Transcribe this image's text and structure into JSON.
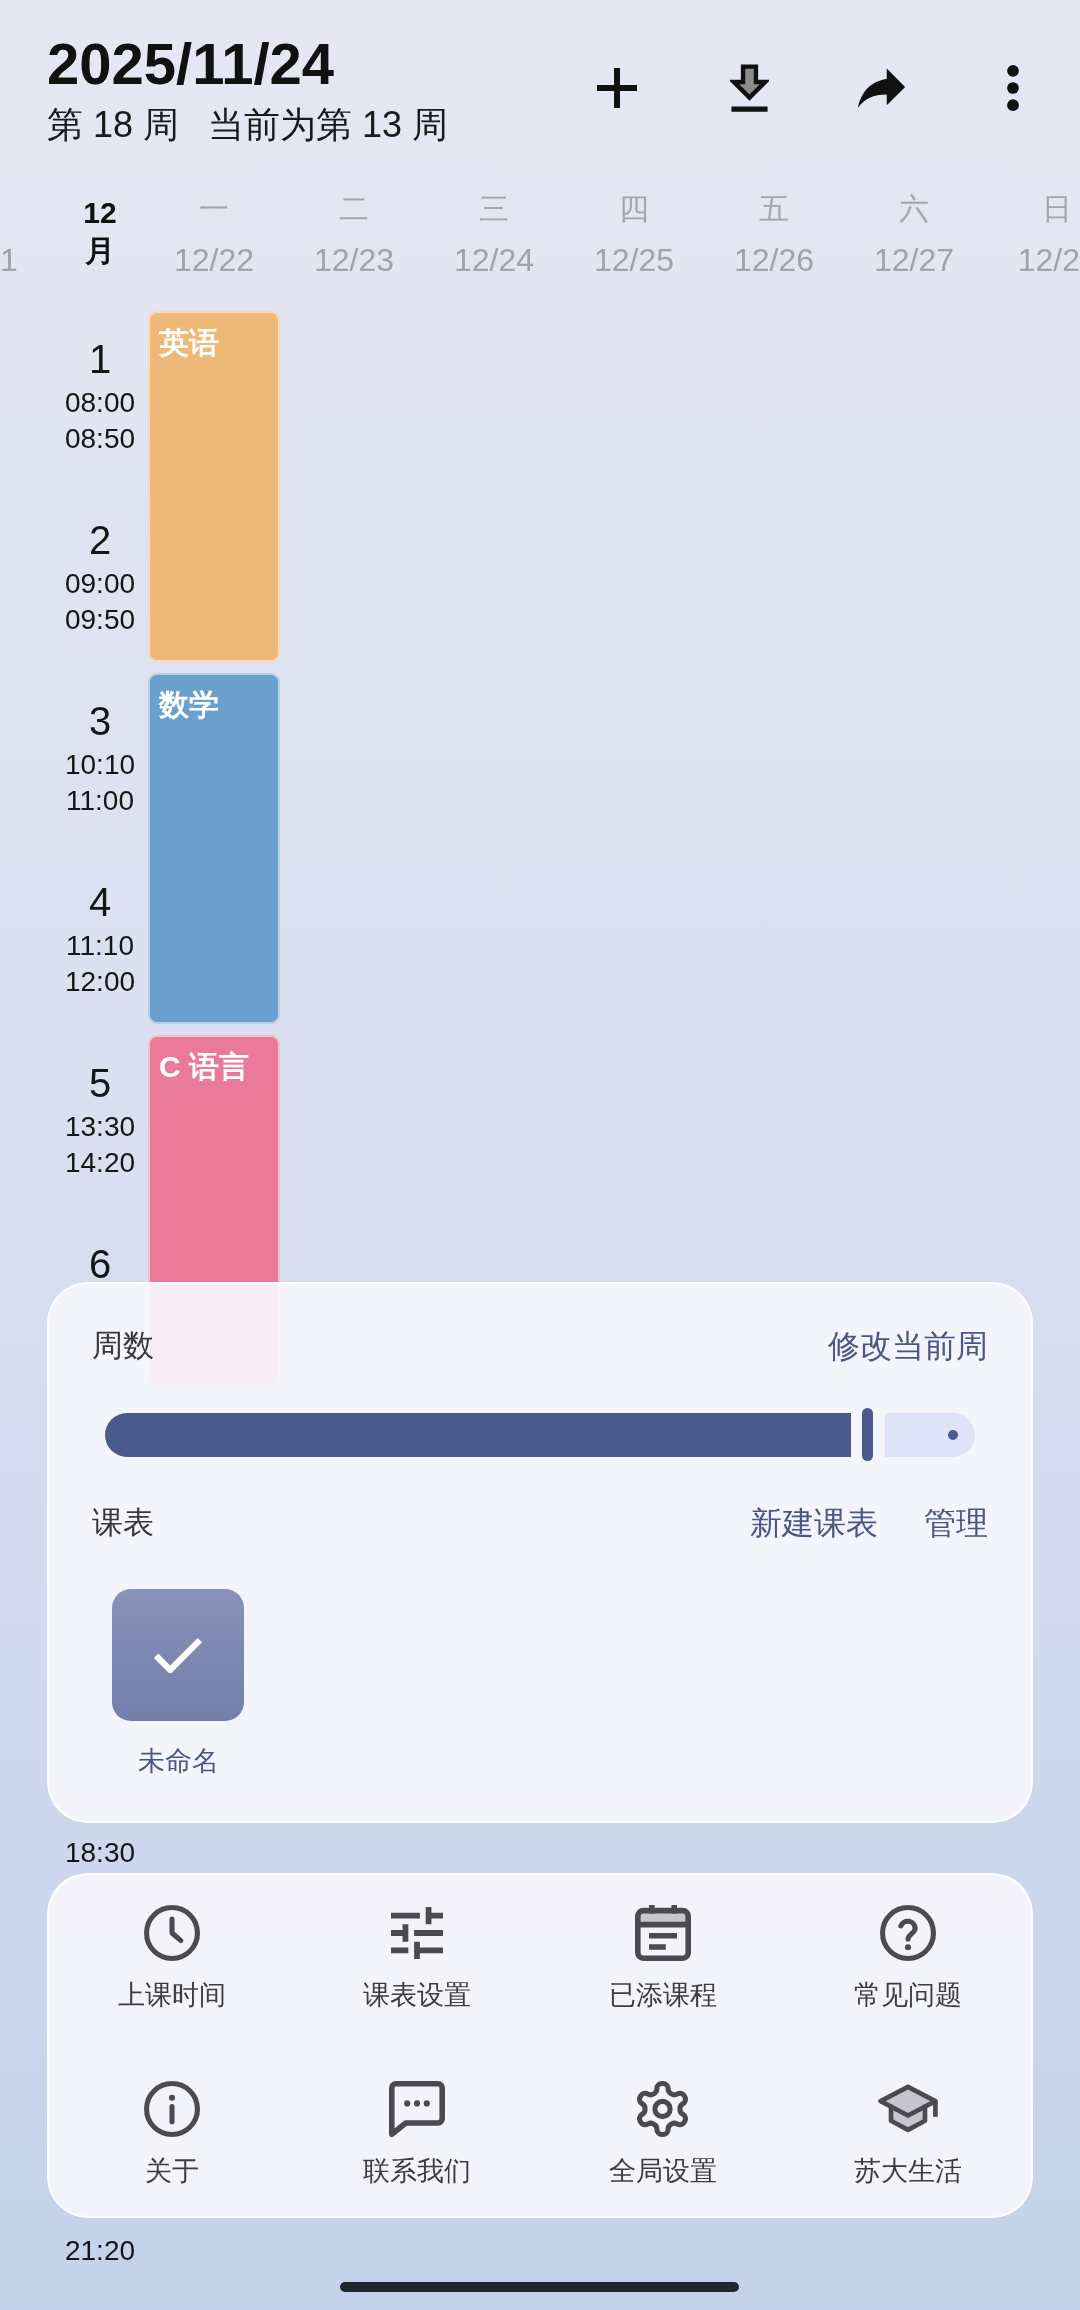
{
  "header": {
    "date": "2025/11/24",
    "week": "第 18 周",
    "current_week": "当前为第 13 周"
  },
  "timetable": {
    "cut_date": "1",
    "month": {
      "number": "12",
      "unit": "月"
    },
    "days": [
      {
        "weekday": "一",
        "date": "12/22",
        "courses": [
          {
            "name": "英语",
            "color": "#eeb877"
          },
          {
            "name": "数学",
            "color": "#6b9fce"
          },
          {
            "name": "C 语言",
            "color": "#e97a9a"
          }
        ]
      },
      {
        "weekday": "二",
        "date": "12/23"
      },
      {
        "weekday": "三",
        "date": "12/24"
      },
      {
        "weekday": "四",
        "date": "12/25"
      },
      {
        "weekday": "五",
        "date": "12/26"
      },
      {
        "weekday": "六",
        "date": "12/27"
      },
      {
        "weekday": "日",
        "date": "12/2"
      }
    ],
    "periods": [
      {
        "number": "1",
        "start": "08:00",
        "end": "08:50"
      },
      {
        "number": "2",
        "start": "09:00",
        "end": "09:50"
      },
      {
        "number": "3",
        "start": "10:10",
        "end": "11:00"
      },
      {
        "number": "4",
        "start": "11:10",
        "end": "12:00"
      },
      {
        "number": "5",
        "start": "13:30",
        "end": "14:20"
      },
      {
        "number": "6"
      }
    ],
    "uncovered_times": [
      "18:30",
      "21:20"
    ]
  },
  "sheet": {
    "week_label": "周数",
    "edit_week": "修改当前周",
    "week_slider": {
      "level": 0.87
    },
    "schedule_label": "课表",
    "schedule_actions": [
      "新建课表",
      "管理"
    ],
    "schedules": [
      {
        "name": "未命名",
        "selected": true
      }
    ]
  },
  "menu": [
    "上课时间",
    "课表设置",
    "已添课程",
    "常见问题",
    "关于",
    "联系我们",
    "全局设置",
    "苏大生活"
  ]
}
